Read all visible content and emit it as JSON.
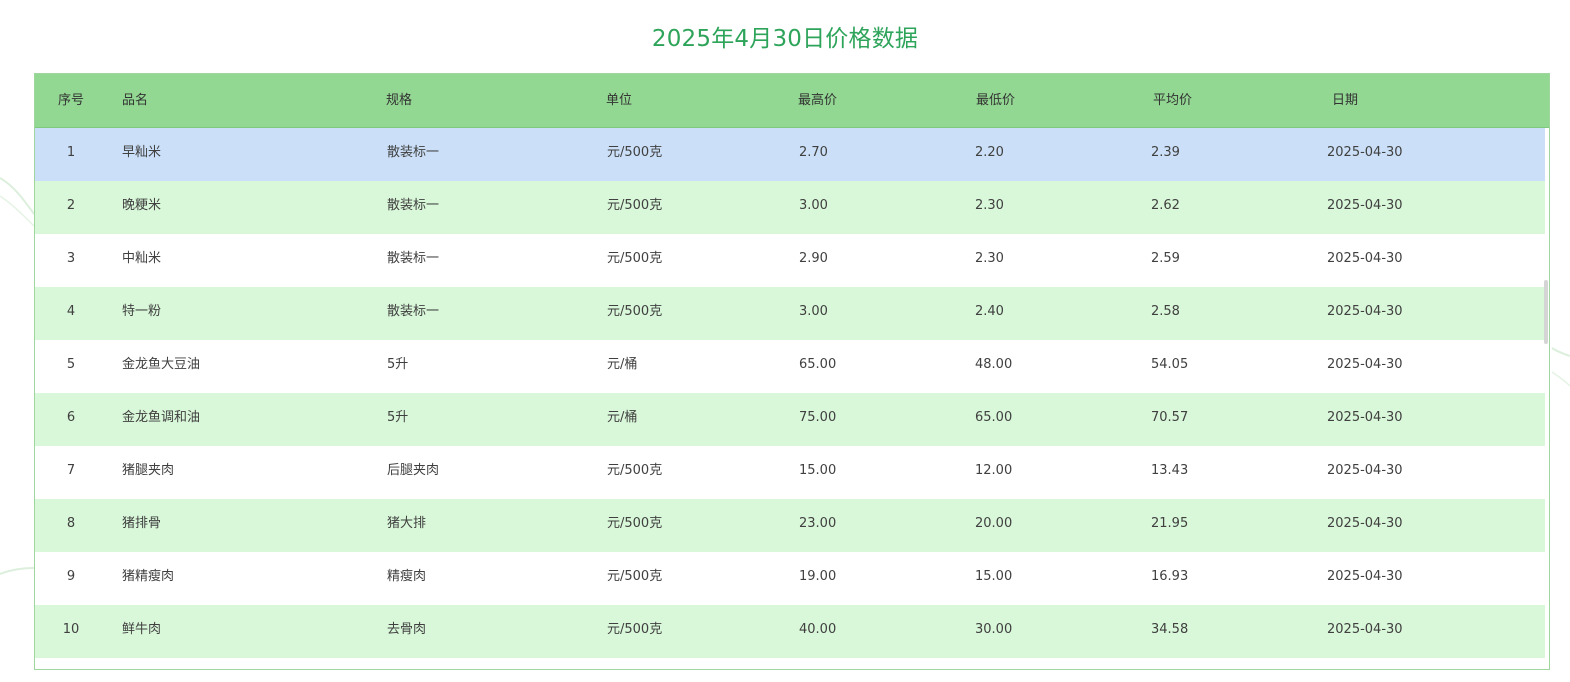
{
  "title": "2025年4月30日价格数据",
  "columns": [
    "序号",
    "品名",
    "规格",
    "单位",
    "最高价",
    "最低价",
    "平均价",
    "日期"
  ],
  "rows": [
    {
      "idx": "1",
      "name": "早籼米",
      "spec": "散装标一",
      "unit": "元/500克",
      "high": "2.70",
      "low": "2.20",
      "avg": "2.39",
      "date": "2025-04-30"
    },
    {
      "idx": "2",
      "name": "晚粳米",
      "spec": "散装标一",
      "unit": "元/500克",
      "high": "3.00",
      "low": "2.30",
      "avg": "2.62",
      "date": "2025-04-30"
    },
    {
      "idx": "3",
      "name": "中籼米",
      "spec": "散装标一",
      "unit": "元/500克",
      "high": "2.90",
      "low": "2.30",
      "avg": "2.59",
      "date": "2025-04-30"
    },
    {
      "idx": "4",
      "name": "特一粉",
      "spec": "散装标一",
      "unit": "元/500克",
      "high": "3.00",
      "low": "2.40",
      "avg": "2.58",
      "date": "2025-04-30"
    },
    {
      "idx": "5",
      "name": "金龙鱼大豆油",
      "spec": "5升",
      "unit": "元/桶",
      "high": "65.00",
      "low": "48.00",
      "avg": "54.05",
      "date": "2025-04-30"
    },
    {
      "idx": "6",
      "name": "金龙鱼调和油",
      "spec": "5升",
      "unit": "元/桶",
      "high": "75.00",
      "low": "65.00",
      "avg": "70.57",
      "date": "2025-04-30"
    },
    {
      "idx": "7",
      "name": "猪腿夹肉",
      "spec": "后腿夹肉",
      "unit": "元/500克",
      "high": "15.00",
      "low": "12.00",
      "avg": "13.43",
      "date": "2025-04-30"
    },
    {
      "idx": "8",
      "name": "猪排骨",
      "spec": "猪大排",
      "unit": "元/500克",
      "high": "23.00",
      "low": "20.00",
      "avg": "21.95",
      "date": "2025-04-30"
    },
    {
      "idx": "9",
      "name": "猪精瘦肉",
      "spec": "精瘦肉",
      "unit": "元/500克",
      "high": "19.00",
      "low": "15.00",
      "avg": "16.93",
      "date": "2025-04-30"
    },
    {
      "idx": "10",
      "name": "鲜牛肉",
      "spec": "去骨肉",
      "unit": "元/500克",
      "high": "40.00",
      "low": "30.00",
      "avg": "34.58",
      "date": "2025-04-30"
    }
  ],
  "selected_row": 1,
  "colors": {
    "title": "#2ea45a",
    "header_bg": "#92d792",
    "row_stripe": "#d9f7d9",
    "row_selected": "#cbe0f8",
    "border": "#9ed69e"
  }
}
